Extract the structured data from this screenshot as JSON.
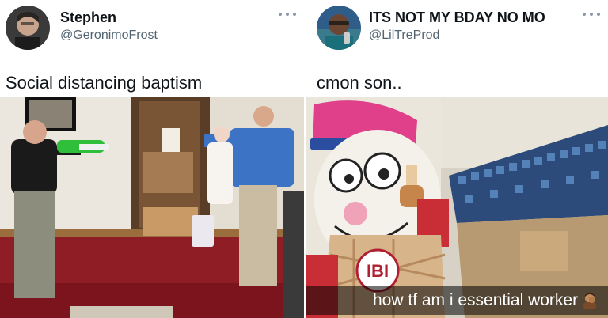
{
  "tweets": [
    {
      "author": {
        "name": "Stephen",
        "handle": "@GeronimoFrost"
      },
      "text": "Social distancing baptism",
      "icons": {
        "avatar": "avatar-photo",
        "more": "more-dots-icon"
      },
      "media": {
        "subject": "baptism-with-water-gun-photo"
      }
    },
    {
      "author": {
        "name": "ITS NOT MY BDAY NO MO",
        "handle": "@LilTreProd"
      },
      "text": "cmon son..",
      "icons": {
        "avatar": "avatar-photo",
        "more": "more-dots-icon"
      },
      "media": {
        "subject": "mascot-selfie-photo",
        "caption": "how tf am i essential worker",
        "caption_emoji": "person-facepalming-emoji",
        "badge_text": "IBI"
      }
    }
  ],
  "colors": {
    "name": "#0f1419",
    "handle": "#536471",
    "more": "#8b98a5"
  }
}
